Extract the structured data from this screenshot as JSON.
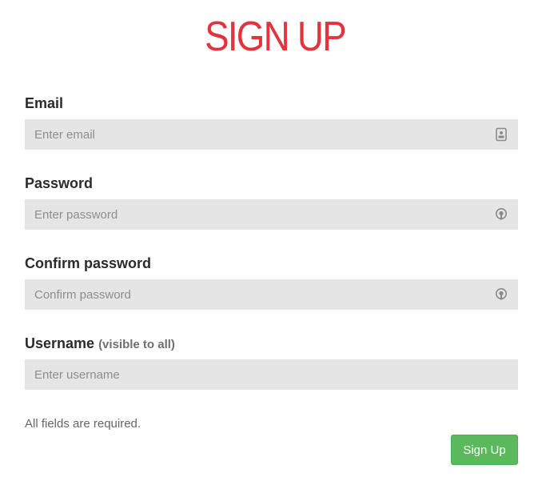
{
  "page_title": "SIGN UP",
  "form": {
    "email": {
      "label": "Email",
      "placeholder": "Enter email",
      "value": "",
      "icon": "id-badge-icon"
    },
    "password": {
      "label": "Password",
      "placeholder": "Enter password",
      "value": "",
      "icon": "key-icon"
    },
    "confirm_password": {
      "label": "Confirm password",
      "placeholder": "Confirm password",
      "value": "",
      "icon": "key-icon"
    },
    "username": {
      "label": "Username",
      "hint": "(visible to all)",
      "placeholder": "Enter username",
      "value": ""
    },
    "required_note": "All fields are required.",
    "submit_label": "Sign Up"
  },
  "colors": {
    "title": "#e3333c",
    "input_background": "#e5e5e5",
    "button_background": "#5cb85c",
    "button_text": "#ffffff"
  }
}
